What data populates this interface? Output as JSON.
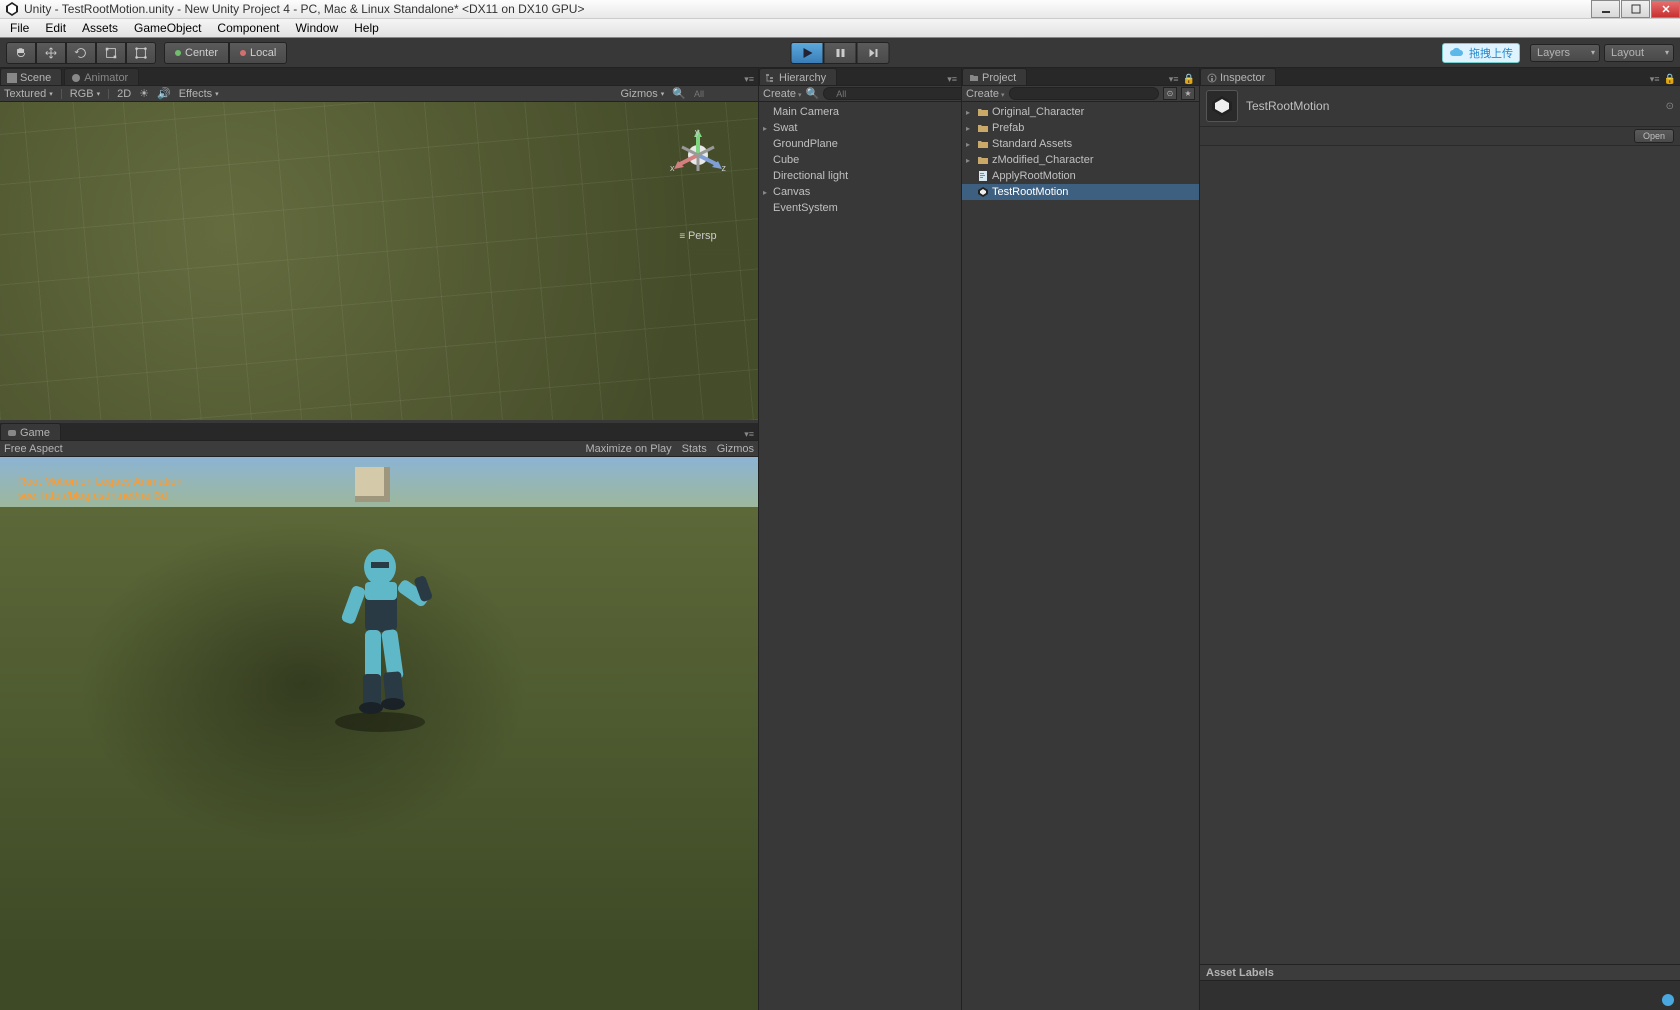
{
  "titlebar": {
    "app": "Unity",
    "title": "Unity - TestRootMotion.unity - New Unity Project 4 - PC, Mac & Linux Standalone* <DX11 on DX10 GPU>"
  },
  "menubar": [
    "File",
    "Edit",
    "Assets",
    "GameObject",
    "Component",
    "Window",
    "Help"
  ],
  "toolbar": {
    "center": "Center",
    "local": "Local",
    "layers": "Layers",
    "layout": "Layout",
    "cloud_badge": "拖拽上传"
  },
  "scene": {
    "tab_scene": "Scene",
    "tab_animator": "Animator",
    "shading": "Textured",
    "render": "RGB",
    "twoD": "2D",
    "effects": "Effects",
    "gizmos": "Gizmos",
    "search_placeholder": "All",
    "axis_x": "x",
    "axis_y": "y",
    "axis_z": "z",
    "persp": "Persp"
  },
  "game": {
    "tab": "Game",
    "aspect": "Free Aspect",
    "maximize": "Maximize on Play",
    "stats": "Stats",
    "gizmos": "Gizmos",
    "overlay_line1": "Root Motion on  Legacy Animation",
    "overlay_line2": "see: http://blog.csdn.net/neil3d"
  },
  "hierarchy": {
    "tab": "Hierarchy",
    "create": "Create",
    "search_placeholder": "All",
    "items": [
      {
        "name": "Main Camera",
        "arrow": ""
      },
      {
        "name": "Swat",
        "arrow": "▸"
      },
      {
        "name": "GroundPlane",
        "arrow": ""
      },
      {
        "name": "Cube",
        "arrow": ""
      },
      {
        "name": "Directional light",
        "arrow": ""
      },
      {
        "name": "Canvas",
        "arrow": "▸"
      },
      {
        "name": "EventSystem",
        "arrow": ""
      }
    ]
  },
  "project": {
    "tab": "Project",
    "create": "Create",
    "search_placeholder": "",
    "items": [
      {
        "name": "Original_Character",
        "icon": "folder",
        "arrow": "▸",
        "indent": 0
      },
      {
        "name": "Prefab",
        "icon": "folder",
        "arrow": "▸",
        "indent": 0
      },
      {
        "name": "Standard Assets",
        "icon": "folder",
        "arrow": "▸",
        "indent": 0
      },
      {
        "name": "zModified_Character",
        "icon": "folder",
        "arrow": "▸",
        "indent": 0
      },
      {
        "name": "ApplyRootMotion",
        "icon": "script",
        "arrow": "",
        "indent": 0
      },
      {
        "name": "TestRootMotion",
        "icon": "unity",
        "arrow": "",
        "indent": 0,
        "selected": true
      }
    ]
  },
  "inspector": {
    "tab": "Inspector",
    "asset_name": "TestRootMotion",
    "open": "Open",
    "asset_labels": "Asset Labels"
  }
}
